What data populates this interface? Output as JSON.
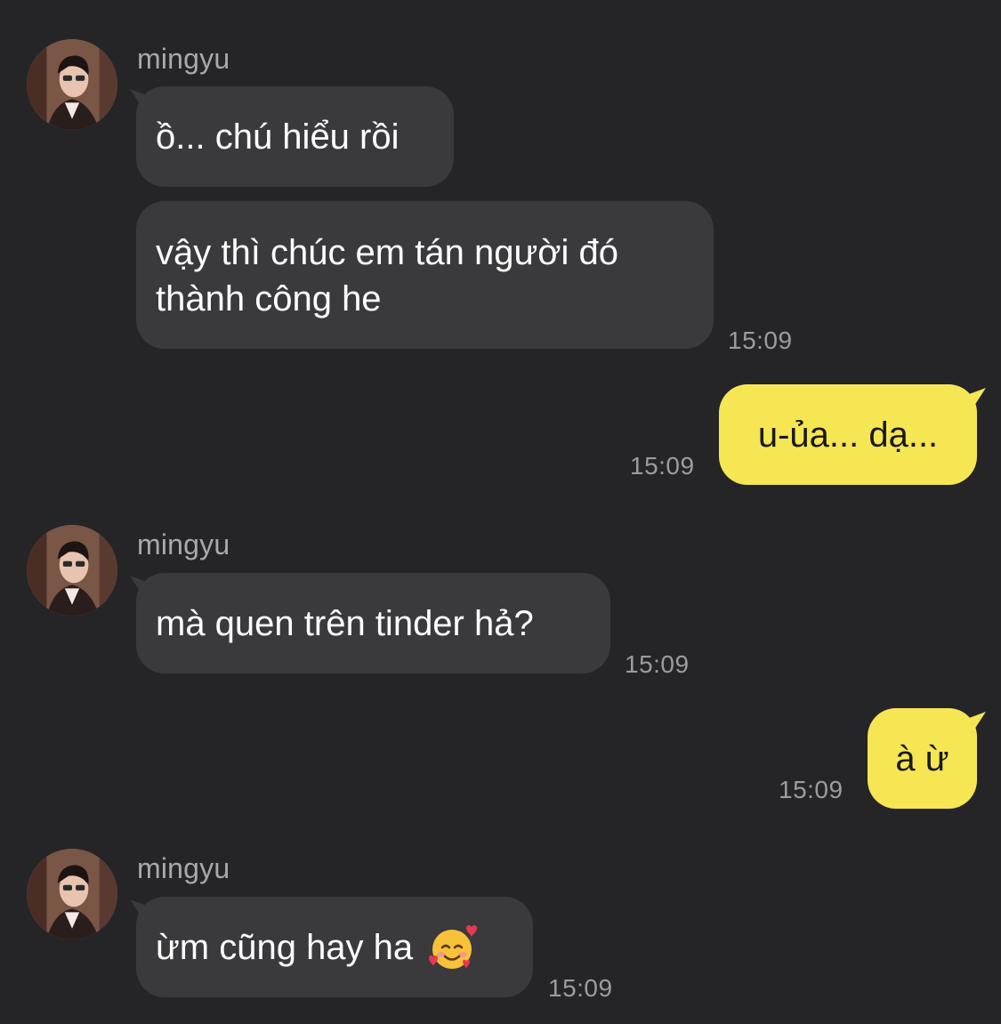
{
  "contact": {
    "name": "mingyu"
  },
  "messages": [
    {
      "from": "contact",
      "text": "ồ... chú hiểu rồi"
    },
    {
      "from": "contact",
      "text": "vậy thì chúc em tán người đó thành công he",
      "time": "15:09"
    },
    {
      "from": "me",
      "text": "u-ủa... dạ...",
      "time": "15:09"
    },
    {
      "from": "contact",
      "text": "mà quen trên tinder hả?",
      "time": "15:09"
    },
    {
      "from": "me",
      "text": "à ừ",
      "time": "15:09"
    },
    {
      "from": "contact",
      "text": "ừm cũng hay ha",
      "emoji": "smiling-face-with-hearts",
      "time": "15:09"
    }
  ],
  "colors": {
    "background": "#252528",
    "incoming_bubble": "#3a3a3d",
    "outgoing_bubble": "#f6e653",
    "timestamp": "#9c9ca0",
    "sender_name": "#a9a9ad"
  }
}
